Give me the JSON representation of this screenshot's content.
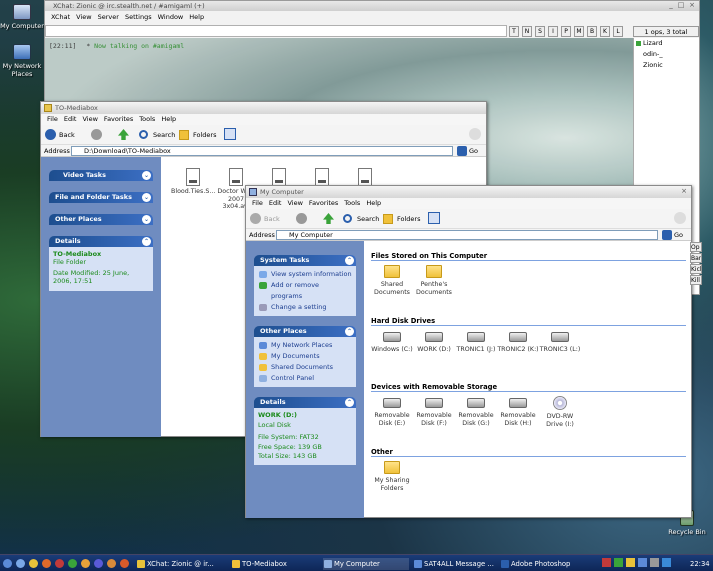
{
  "desktop": {
    "icons": [
      {
        "label": "My Computer"
      },
      {
        "label": "My Network Places"
      },
      {
        "label": "Recycle Bin"
      }
    ]
  },
  "xchat": {
    "title": "XChat: Zionic @ irc.stealth.net / #amigaml (+)",
    "menu": [
      "XChat",
      "View",
      "Server",
      "Settings",
      "Window",
      "Help"
    ],
    "modes": [
      "T",
      "N",
      "S",
      "I",
      "P",
      "M",
      "B",
      "K",
      "L"
    ],
    "user_count": "1 ops, 3 total",
    "users": [
      "Lizard",
      "odin-_",
      "Zionic"
    ],
    "chat": {
      "time": "[22:11]",
      "marker": "*",
      "text": "Now talking on #amigaml"
    },
    "partial_buttons": [
      "Op",
      "Ban",
      "Kick",
      "Kill"
    ]
  },
  "mediabox": {
    "title": "TO-Mediabox",
    "menu": [
      "File",
      "Edit",
      "View",
      "Favorites",
      "Tools",
      "Help"
    ],
    "toolbar": {
      "back": "Back",
      "search": "Search",
      "folders": "Folders"
    },
    "address_label": "Address",
    "address": "D:\\Download\\TO-Mediabox",
    "go": "Go",
    "panels": {
      "video": "Video Tasks",
      "filefolder": "File and Folder Tasks",
      "other": "Other Places",
      "details": "Details"
    },
    "details": {
      "name": "TO-Mediabox",
      "type": "File Folder",
      "modified": "Date Modified: 25 June, 2006, 17:51"
    },
    "files": [
      {
        "name": "Blood.Ties.S..."
      },
      {
        "name": "Doctor Who 2007 3x04.avi"
      },
      {
        "name": ""
      },
      {
        "name": ""
      },
      {
        "name": ""
      }
    ]
  },
  "mycomputer": {
    "title": "My Computer",
    "menu": [
      "File",
      "Edit",
      "View",
      "Favorites",
      "Tools",
      "Help"
    ],
    "toolbar": {
      "back": "Back",
      "search": "Search",
      "folders": "Folders"
    },
    "address_label": "Address",
    "address": "My Computer",
    "go": "Go",
    "system_tasks": {
      "title": "System Tasks",
      "items": [
        "View system information",
        "Add or remove programs",
        "Change a setting"
      ]
    },
    "other_places": {
      "title": "Other Places",
      "items": [
        "My Network Places",
        "My Documents",
        "Shared Documents",
        "Control Panel"
      ]
    },
    "details": {
      "title": "Details",
      "name": "WORK (D:)",
      "type": "Local Disk",
      "fs": "File System: FAT32",
      "free": "Free Space: 139 GB",
      "total": "Total Size: 143 GB"
    },
    "sections": {
      "stored": {
        "title": "Files Stored on This Computer",
        "items": [
          "Shared Documents",
          "Penthe's Documents"
        ]
      },
      "hdd": {
        "title": "Hard Disk Drives",
        "items": [
          "Windows (C:)",
          "WORK (D:)",
          "TRONIC1 (J:)",
          "TRONIC2 (K:)",
          "TRONIC3 (L:)"
        ]
      },
      "removable": {
        "title": "Devices with Removable Storage",
        "items": [
          "Removable Disk (E:)",
          "Removable Disk (F:)",
          "Removable Disk (G:)",
          "Removable Disk (H:)",
          "DVD-RW Drive (I:)"
        ]
      },
      "other": {
        "title": "Other",
        "items": [
          "My Sharing Folders"
        ]
      }
    }
  },
  "taskbar": {
    "tasks": [
      "XChat: Zionic @ ir...",
      "TO-Mediabox",
      "My Computer",
      "SAT4ALL Message ...",
      "Adobe Photoshop"
    ],
    "clock": "22:34"
  },
  "colors": {
    "panel_header": "#2b5fad",
    "panel_body": "#d6e1f5",
    "link": "#1b3d8f",
    "detail_green": "#1b8a1b",
    "taskbar": "#12306a"
  }
}
